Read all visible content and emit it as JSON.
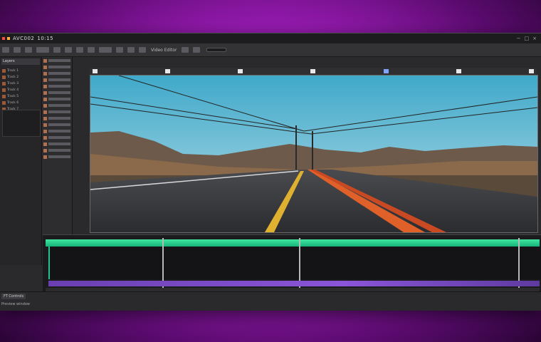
{
  "app": {
    "title": "AVC002",
    "title_suffix": "10:15"
  },
  "toolbar": {
    "label": "Video Editor"
  },
  "left_panel": {
    "header": "Layers",
    "items": [
      "Track 1",
      "Track 2",
      "Track 3",
      "Track 4",
      "Track 5",
      "Track 6",
      "Track 7",
      "Track 8",
      "Track 9",
      "Track 10"
    ]
  },
  "status": {
    "line1": "FT Controls",
    "line2": "Preview window"
  },
  "colors": {
    "accent_green": "#2fd68e",
    "audio_purple": "#7a48c8",
    "background_magenta": "#c23ad6"
  }
}
